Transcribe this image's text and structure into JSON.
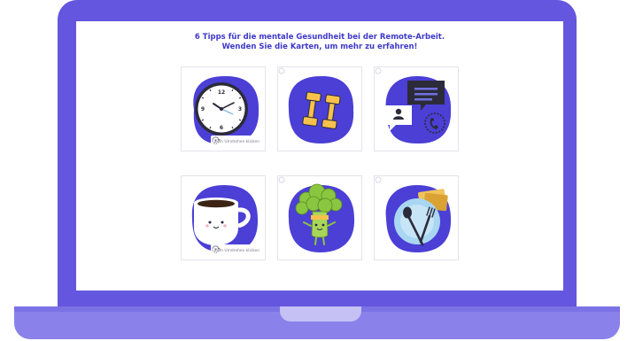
{
  "intro": {
    "line1": "6 Tipps für die mentale Gesundheit bei der Remote-Arbeit.",
    "line2": "Wenden Sie die Karten, um mehr zu erfahren!"
  },
  "cards": [
    {
      "icon": "clock-icon",
      "hint": "Zum Umdrehen klicken"
    },
    {
      "icon": "dumbbell-icon",
      "hint": ""
    },
    {
      "icon": "chat-icon",
      "hint": ""
    },
    {
      "icon": "coffee-cup-icon",
      "hint": "Zum Umdrehen klicken"
    },
    {
      "icon": "broccoli-icon",
      "hint": ""
    },
    {
      "icon": "plate-cutlery-icon",
      "hint": ""
    }
  ],
  "colors": {
    "frame": "#6456de",
    "base": "#8a82ea",
    "blob": "#4b3fd6",
    "title": "#3f39c9",
    "accent_yellow": "#f7c14c",
    "accent_green": "#8ac640"
  }
}
